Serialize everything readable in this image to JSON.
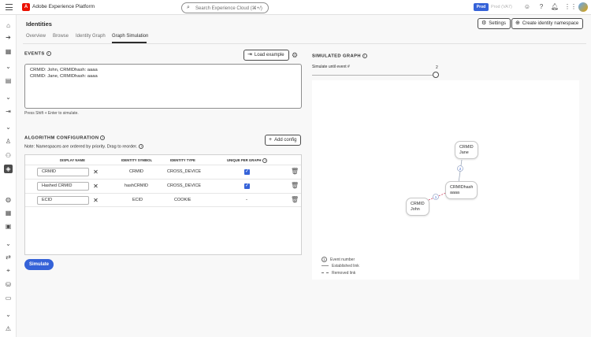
{
  "app": {
    "title": "Adobe Experience Platform",
    "logo": "A",
    "search_placeholder": "Search Experience Cloud (⌘+/)",
    "sandbox_badge": "Prod",
    "sandbox_name": "Prod (VA7)"
  },
  "page": {
    "title": "Identities",
    "settings_label": "Settings",
    "create_namespace_label": "Create identity namespace"
  },
  "tabs": [
    {
      "label": "Overview"
    },
    {
      "label": "Browse"
    },
    {
      "label": "Identity Graph"
    },
    {
      "label": "Graph Simulation",
      "selected": true
    }
  ],
  "events": {
    "heading": "EVENTS",
    "load_example_label": "Load example",
    "lines": [
      "CRMID: John, CRMIDhash: aaaa",
      "CRMID: Jane, CRMIDhash: aaaa"
    ],
    "hint": "Press Shift + Enter to simulate."
  },
  "algorithm": {
    "heading": "ALGORITHM CONFIGURATION",
    "add_config_label": "Add config",
    "note": "Note: Namespaces are ordered by priority. Drag to reorder.",
    "columns": [
      "DISPLAY NAME",
      "IDENTITY SYMBOL",
      "IDENTITY TYPE",
      "UNIQUE PER GRAPH"
    ],
    "rows": [
      {
        "display_name": "CRMID",
        "symbol": "CRMID",
        "type": "CROSS_DEVICE",
        "unique": true
      },
      {
        "display_name": "Hashed CRMID",
        "symbol": "hashCRMID",
        "type": "CROSS_DEVICE",
        "unique": true
      },
      {
        "display_name": "ECID",
        "symbol": "ECID",
        "type": "COOKIE",
        "unique": false,
        "unique_text": "-"
      }
    ],
    "simulate_label": "Simulate"
  },
  "graph": {
    "heading": "SIMULATED GRAPH",
    "slider_label": "Simulate until event #",
    "slider_value": "2",
    "nodes": {
      "jane": {
        "line1": "CRMID",
        "line2": "Jane"
      },
      "crmidhash": {
        "line1": "CRMIDhash",
        "line2": "aaaa"
      },
      "john": {
        "line1": "CRMID",
        "line2": "John"
      }
    },
    "edge_labels": {
      "jane_hash": "2",
      "hash_john": "1"
    },
    "legend": {
      "event_number_marker": "1",
      "event_number": "Event number",
      "established": "Established link",
      "removed": "Removed link"
    }
  },
  "colors": {
    "accent": "#3562d8",
    "adobe_red": "#eb1000",
    "established_link": "#b3b3b3",
    "removed_link": "#d04060"
  },
  "icons": {
    "rail": [
      "home-icon",
      "arrow-right-icon",
      "grid-icon",
      "chevron-down-icon",
      "data-icon",
      "chevron-down-icon",
      "import-icon",
      "chevron-down-icon",
      "user-icon",
      "people-icon",
      "identity-icon",
      "segments-icon",
      "grid-icon",
      "policy-icon",
      "chevron-down-icon",
      "flow-icon",
      "location-icon",
      "database-icon",
      "monitor-icon",
      "chevron-down-icon",
      "alert-icon"
    ]
  }
}
